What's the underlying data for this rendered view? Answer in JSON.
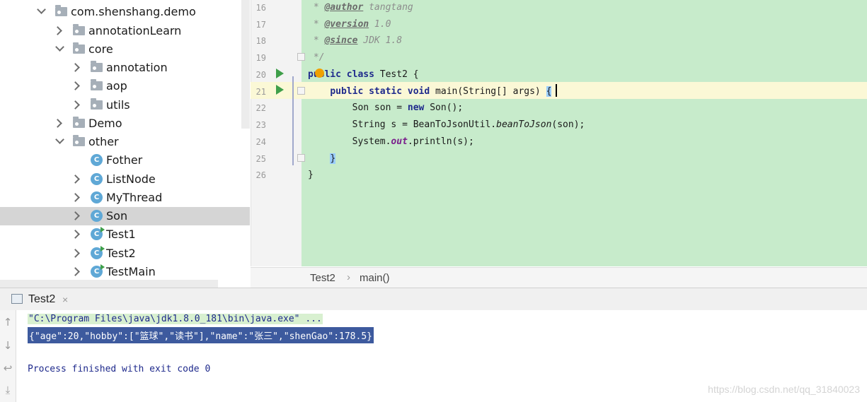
{
  "project_tree": {
    "items": [
      {
        "label": "com.shenshang.demo",
        "type": "package",
        "depth": 1,
        "expanded": true
      },
      {
        "label": "annotationLearn",
        "type": "package",
        "depth": 2,
        "expanded": false
      },
      {
        "label": "core",
        "type": "package",
        "depth": 2,
        "expanded": true
      },
      {
        "label": "annotation",
        "type": "package",
        "depth": 3,
        "expanded": false
      },
      {
        "label": "aop",
        "type": "package",
        "depth": 3,
        "expanded": false
      },
      {
        "label": "utils",
        "type": "package",
        "depth": 3,
        "expanded": false
      },
      {
        "label": "Demo",
        "type": "package",
        "depth": 2,
        "expanded": false
      },
      {
        "label": "other",
        "type": "package",
        "depth": 2,
        "expanded": true
      },
      {
        "label": "Fother",
        "type": "class",
        "depth": 3
      },
      {
        "label": "ListNode",
        "type": "class",
        "depth": 3
      },
      {
        "label": "MyThread",
        "type": "class",
        "depth": 3
      },
      {
        "label": "Son",
        "type": "class",
        "depth": 3,
        "selected": true
      },
      {
        "label": "Test1",
        "type": "runnable-class",
        "depth": 3
      },
      {
        "label": "Test2",
        "type": "runnable-class",
        "depth": 3
      },
      {
        "label": "TestMain",
        "type": "runnable-class",
        "depth": 3
      }
    ],
    "class_icon_letter": "C"
  },
  "editor": {
    "line_numbers": [
      "16",
      "17",
      "18",
      "19",
      "20",
      "21",
      "22",
      "23",
      "24",
      "25",
      "26"
    ],
    "lines": {
      "l16": {
        "prefix": " * ",
        "tag": "@author",
        "rest": " tangtang"
      },
      "l17": {
        "prefix": " * ",
        "tag": "@version",
        "rest": " 1.0"
      },
      "l18": {
        "prefix": " * ",
        "tag": "@since",
        "rest": " JDK 1.8"
      },
      "l19": " */",
      "l20": {
        "kw1": "public",
        "kw2": "class",
        "rest": " Test2 {"
      },
      "l21": {
        "indent": "    ",
        "kw1": "public",
        "kw2": "static",
        "kw3": "void",
        "rest": " main(String[] args) ",
        "brace": "{"
      },
      "l22": {
        "indent": "        ",
        "pre": "Son son = ",
        "kw": "new",
        "post": " Son();"
      },
      "l23": {
        "indent": "        ",
        "pre": "String s = BeanToJsonUtil.",
        "method": "beanToJson",
        "post": "(son);"
      },
      "l24": {
        "indent": "        ",
        "pre": "System.",
        "field": "out",
        "post": ".println(s);"
      },
      "l25": {
        "indent": "    ",
        "brace": "}"
      },
      "l26": "}"
    }
  },
  "breadcrumb": {
    "class_name": "Test2",
    "separator": "›",
    "method": "main()"
  },
  "run_panel": {
    "tab_label": "Test2",
    "tab_close": "×",
    "console": {
      "command": "\"C:\\Program Files\\java\\jdk1.8.0_181\\bin\\java.exe\" ...",
      "output": "{\"age\":20,\"hobby\":[\"篮球\",\"读书\"],\"name\":\"张三\",\"shenGao\":178.5}",
      "exit": "Process finished with exit code 0"
    },
    "toolbar_icons": [
      "arrow-up-icon",
      "arrow-down-icon",
      "soft-wrap-icon",
      "scroll-to-end-icon"
    ]
  },
  "watermark": "https://blog.csdn.net/qq_31840023",
  "colors": {
    "editor_bg": "#c7ebcb",
    "caret_line": "#fbf8d6",
    "keyword": "#1f2a8c",
    "selection": "#3d5a9e",
    "class_icon": "#5fa8d6"
  }
}
